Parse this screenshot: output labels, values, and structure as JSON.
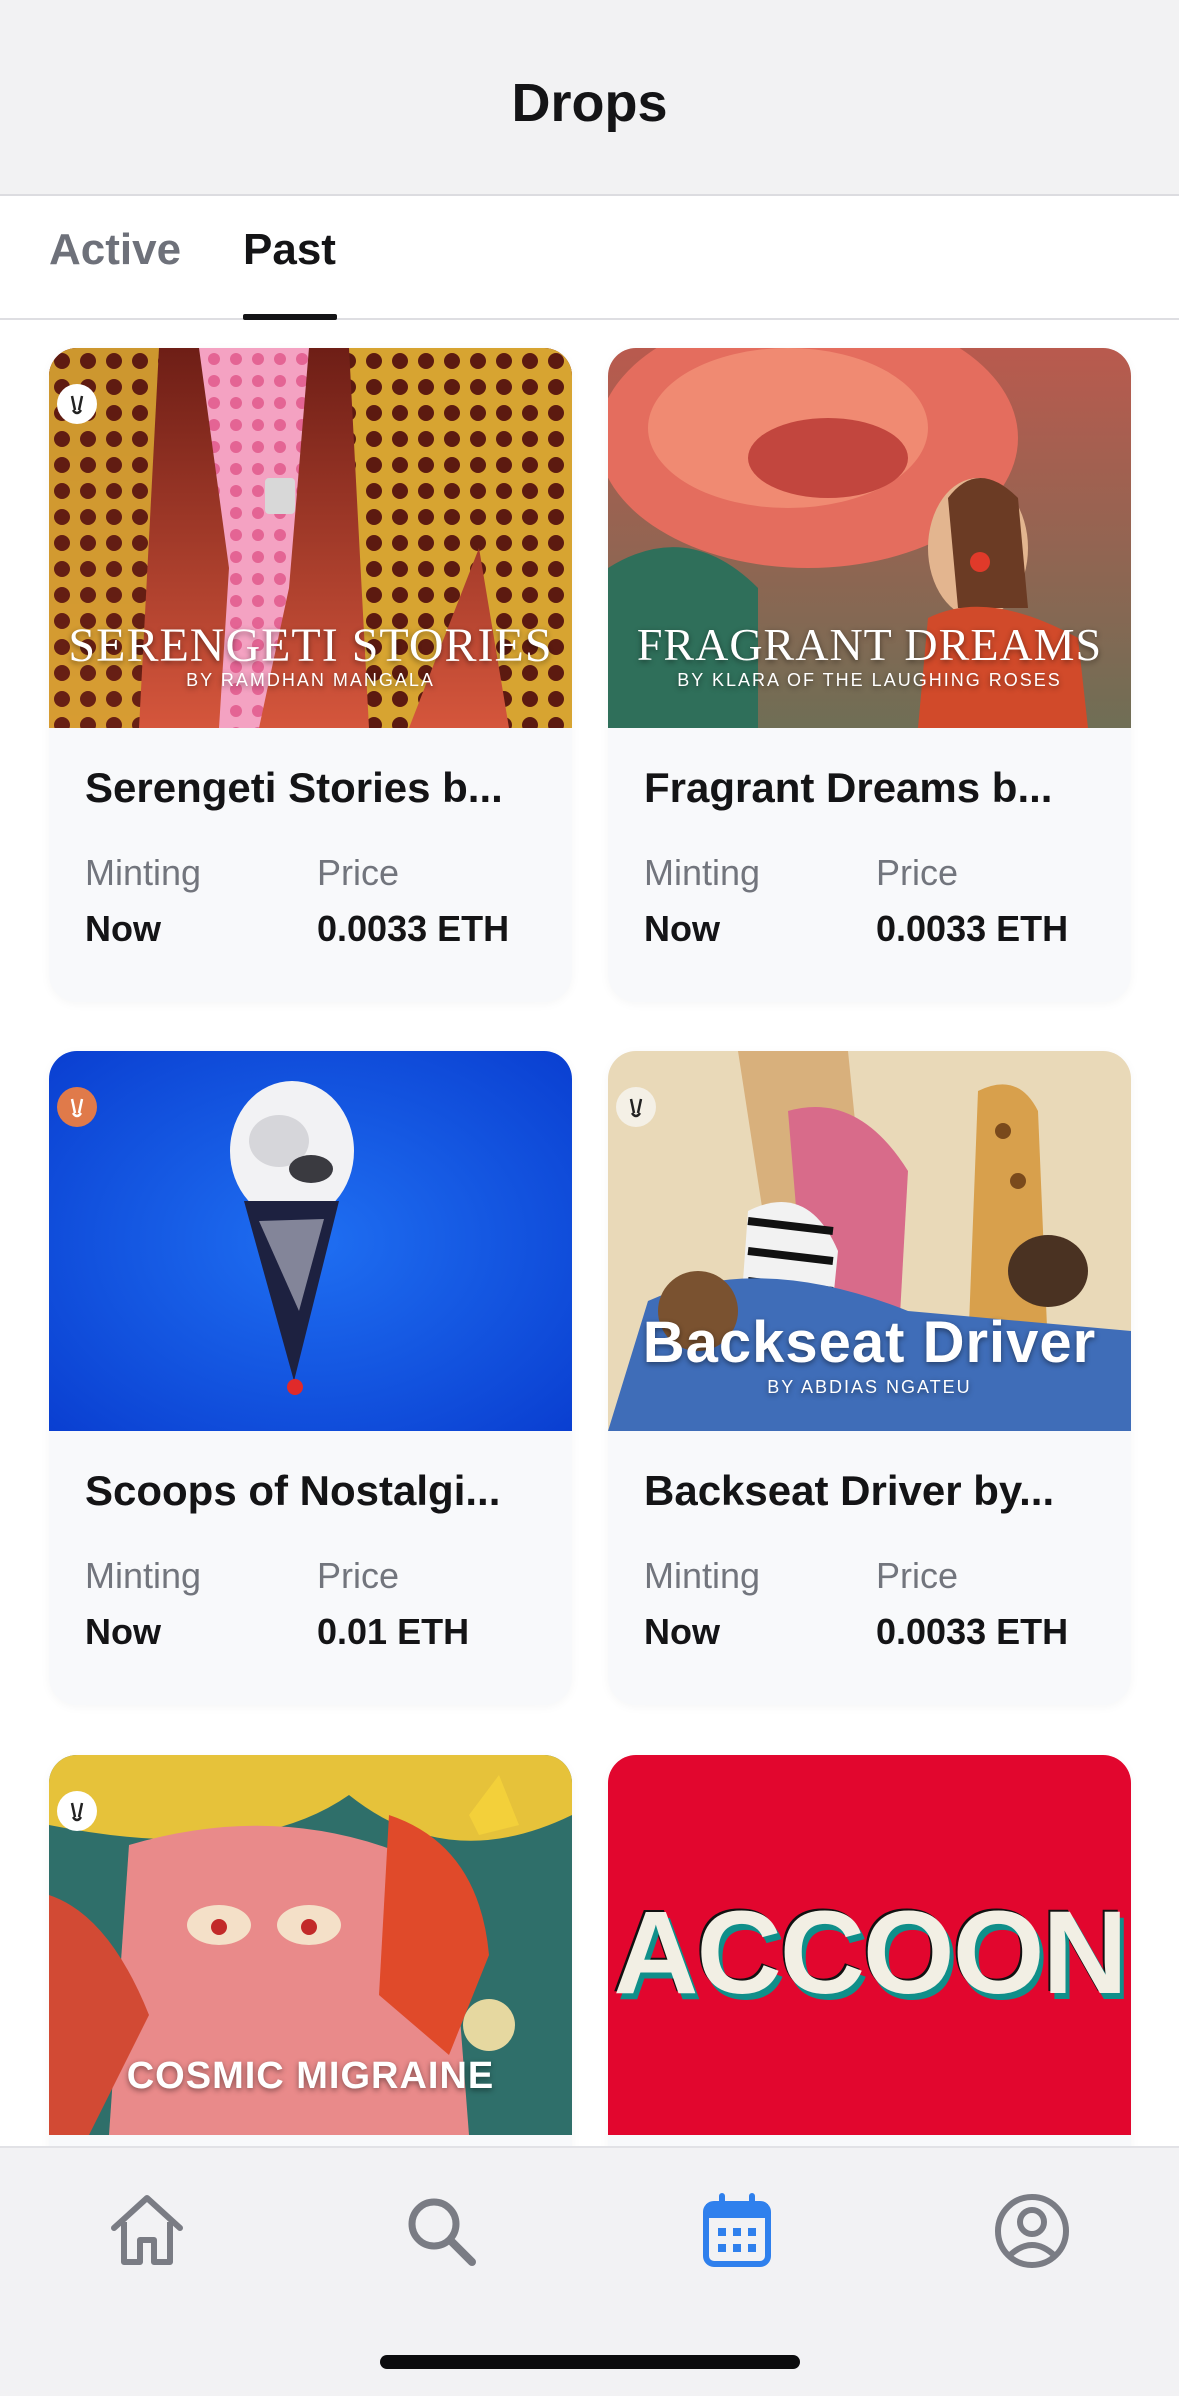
{
  "header": {
    "title": "Drops"
  },
  "tabs": [
    {
      "label": "Active",
      "selected": false
    },
    {
      "label": "Past",
      "selected": true
    }
  ],
  "cards": [
    {
      "title": "Serengeti Stories b...",
      "minting_label": "Minting",
      "minting_value": "Now",
      "price_label": "Price",
      "price_value": "0.0033 ETH",
      "image_title": "SERENGETI STORIES",
      "image_byline": "BY RAMDHAN MANGALA"
    },
    {
      "title": "Fragrant Dreams b...",
      "minting_label": "Minting",
      "minting_value": "Now",
      "price_label": "Price",
      "price_value": "0.0033 ETH",
      "image_title": "FRAGRANT DREAMS",
      "image_byline": "BY KLARA OF THE LAUGHING ROSES"
    },
    {
      "title": "Scoops of Nostalgi...",
      "minting_label": "Minting",
      "minting_value": "Now",
      "price_label": "Price",
      "price_value": "0.01 ETH"
    },
    {
      "title": "Backseat Driver by...",
      "minting_label": "Minting",
      "minting_value": "Now",
      "price_label": "Price",
      "price_value": "0.0033 ETH",
      "image_title": "Backseat Driver",
      "image_byline": "BY ABDIAS NGATEU"
    },
    {
      "image_title": "COSMIC MIGRAINE"
    },
    {
      "image_title": "ACCOON"
    }
  ],
  "tabbar": {
    "items": [
      {
        "icon": "home-icon",
        "active": false
      },
      {
        "icon": "search-icon",
        "active": false
      },
      {
        "icon": "calendar-icon",
        "active": true
      },
      {
        "icon": "profile-icon",
        "active": false
      }
    ],
    "active_color": "#2f80ed",
    "inactive_color": "#7a7c84"
  }
}
